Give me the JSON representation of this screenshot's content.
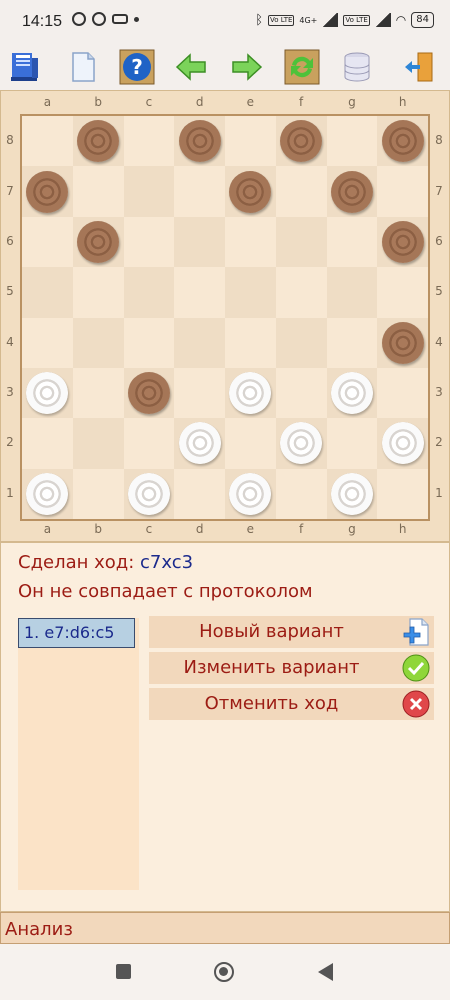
{
  "status_bar": {
    "time": "14:15",
    "battery": "84",
    "volte_label": "Vo LTE",
    "network_label": "4G+"
  },
  "toolbar": {
    "icons": [
      "book-icon",
      "new-document-icon",
      "help-icon",
      "back-arrow-icon",
      "forward-arrow-icon",
      "flip-board-icon",
      "database-icon",
      "exit-door-icon"
    ]
  },
  "board": {
    "files": [
      "a",
      "b",
      "c",
      "d",
      "e",
      "f",
      "g",
      "h"
    ],
    "ranks": [
      "8",
      "7",
      "6",
      "5",
      "4",
      "3",
      "2",
      "1"
    ],
    "pieces": [
      {
        "square": "b8",
        "color": "black"
      },
      {
        "square": "d8",
        "color": "black"
      },
      {
        "square": "f8",
        "color": "black"
      },
      {
        "square": "h8",
        "color": "black"
      },
      {
        "square": "a7",
        "color": "black"
      },
      {
        "square": "e7",
        "color": "black"
      },
      {
        "square": "g7",
        "color": "black"
      },
      {
        "square": "b6",
        "color": "black"
      },
      {
        "square": "h6",
        "color": "black"
      },
      {
        "square": "h4",
        "color": "black"
      },
      {
        "square": "c3",
        "color": "black"
      },
      {
        "square": "a3",
        "color": "white"
      },
      {
        "square": "e3",
        "color": "white"
      },
      {
        "square": "g3",
        "color": "white"
      },
      {
        "square": "d2",
        "color": "white"
      },
      {
        "square": "f2",
        "color": "white"
      },
      {
        "square": "h2",
        "color": "white"
      },
      {
        "square": "a1",
        "color": "white"
      },
      {
        "square": "c1",
        "color": "white"
      },
      {
        "square": "e1",
        "color": "white"
      },
      {
        "square": "g1",
        "color": "white"
      }
    ]
  },
  "info": {
    "move_made_label": "Сделан ход: ",
    "move_made_value": "c7xc3",
    "mismatch_text": "Он не совпадает с протоколом"
  },
  "moves": [
    "1. e7:d6:c5"
  ],
  "actions": {
    "new_variant": "Новый вариант",
    "change_variant": "Изменить вариант",
    "undo_move": "Отменить ход"
  },
  "footer": {
    "analysis_label": "Анализ"
  },
  "colors": {
    "label_red": "#9c1c14",
    "move_blue": "#1b2a8c",
    "board_light": "#f8e8d3",
    "board_dark": "#efddc5"
  }
}
